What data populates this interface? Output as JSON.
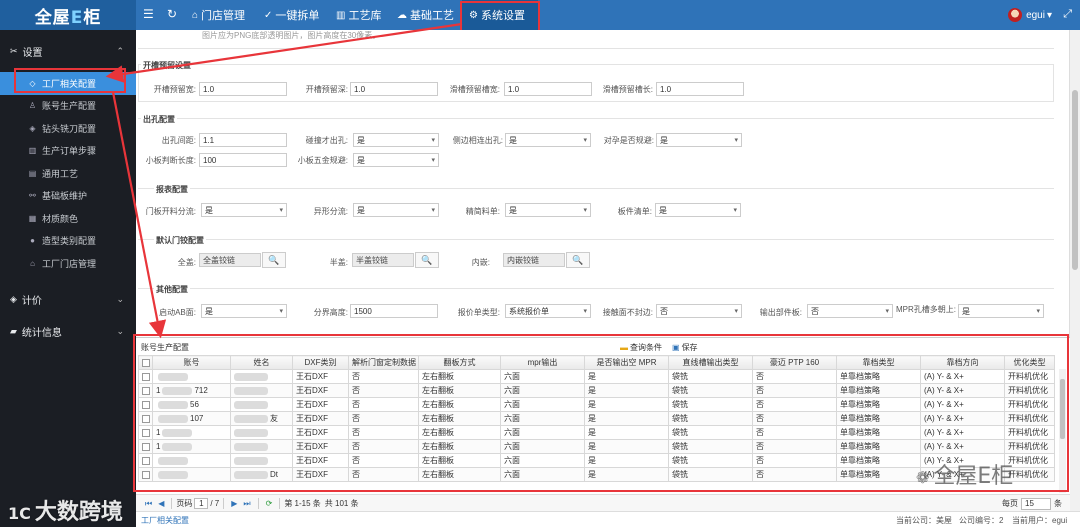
{
  "app": {
    "logo": {
      "part1": "全屋",
      "part2": "E",
      "part3": "柜"
    },
    "nav": [
      {
        "label": "门店管理",
        "glyph": "⌂"
      },
      {
        "label": "一键拆单",
        "glyph": "✓"
      },
      {
        "label": "工艺库",
        "glyph": "▥"
      },
      {
        "label": "基础工艺",
        "glyph": "☁"
      },
      {
        "label": "系统设置",
        "glyph": "⚙"
      }
    ],
    "user": "egui",
    "user_caret": "▾"
  },
  "sidebar": {
    "settings_label": "设置",
    "items": [
      "工厂相关配置",
      "账号生产配置",
      "钻头铣刀配置",
      "生产订单步骤",
      "通用工艺",
      "基础板维护",
      "材质颜色",
      "造型类别配置",
      "工厂门店管理"
    ],
    "pricing_label": "计价",
    "stats_label": "统计信息"
  },
  "form": {
    "hint": "图片应为PNG底部透明图片，图片高度在30像素。",
    "slot": {
      "title": "开槽预留设置",
      "slot_width_label": "开槽预留宽:",
      "slot_width": "1.0",
      "slot_depth_label": "开槽预留深:",
      "slot_depth": "1.0",
      "gap_width_label": "滑槽预留槽宽:",
      "gap_width": "1.0",
      "gap_length_label": "滑槽预留槽长:",
      "gap_length": "1.0"
    },
    "hole": {
      "title": "出孔配置",
      "spacing_label": "出孔间距:",
      "spacing": "1.1",
      "collide_label": "碰撞才出孔:",
      "collide": "是",
      "side_label": "侧边相连出孔:",
      "side": "是",
      "avoid_label": "对孕是否规避:",
      "avoid": "是",
      "min_len_label": "小板判断长度:",
      "min_len": "100",
      "small_hw_label": "小板五金规避:",
      "small_hw": "是"
    },
    "report": {
      "title": "报表配置",
      "door_label": "门板开料分流:",
      "door": "是",
      "special_label": "异形分流:",
      "special": "是",
      "simple_label": "精简料单:",
      "simple": "是",
      "part_list_label": "板件清单:",
      "part_list": "是"
    },
    "hinge": {
      "title": "默认门铰配置",
      "full_label": "全盖:",
      "full": "全盖铰链",
      "half_label": "半盖:",
      "half": "半盖铰链",
      "inner_label": "内嵌:",
      "inner": "内嵌铰链",
      "lookup_icon": "🔍"
    },
    "other": {
      "title": "其他配置",
      "ab_label": "启动AB面:",
      "ab": "是",
      "split_h_label": "分界高度:",
      "split_h": "1500",
      "quote_label": "报价单类型:",
      "quote": "系统报价单",
      "touch_label": "接触面不封边:",
      "touch": "否",
      "output_part_label": "输出部件板:",
      "output_part": "否",
      "mpr_label": "MPR孔槽多朝上:",
      "mpr": "是"
    }
  },
  "grid": {
    "title": "账号生产配置",
    "query_label": "查询条件",
    "save_label": "保存",
    "columns": [
      "账号",
      "姓名",
      "DXF类别",
      "解析门窗定制数据",
      "翻板方式",
      "mpr输出",
      "是否输出空 MPR",
      "直线槽输出类型",
      "豪迈 PTP 160",
      "靠档类型",
      "靠档方向",
      "优化类型"
    ],
    "rows": [
      {
        "account": "",
        "name": "",
        "dxf": "王石DXF",
        "parse": "否",
        "flip": "左右翻板",
        "mpr": "六面",
        "empty": "是",
        "line": "袋铣",
        "hm": "否",
        "dock": "单靠档策略",
        "dir": "(A) Y- & X+",
        "opt": "开料机优化"
      },
      {
        "account": "1",
        "account_suffix": "712",
        "name": "",
        "dxf": "王石DXF",
        "parse": "否",
        "flip": "左右翻板",
        "mpr": "六面",
        "empty": "是",
        "line": "袋铣",
        "hm": "否",
        "dock": "单靠档策略",
        "dir": "(A) Y- & X+",
        "opt": "开料机优化"
      },
      {
        "account": "",
        "account_suffix": "56",
        "name": "",
        "dxf": "王石DXF",
        "parse": "否",
        "flip": "左右翻板",
        "mpr": "六面",
        "empty": "是",
        "line": "袋铣",
        "hm": "否",
        "dock": "单靠档策略",
        "dir": "(A) Y- & X+",
        "opt": "开料机优化"
      },
      {
        "account": "",
        "account_suffix": "107",
        "name": "",
        "name_suffix": "友",
        "dxf": "王石DXF",
        "parse": "否",
        "flip": "左右翻板",
        "mpr": "六面",
        "empty": "是",
        "line": "袋铣",
        "hm": "否",
        "dock": "单靠档策略",
        "dir": "(A) Y- & X+",
        "opt": "开料机优化"
      },
      {
        "account": "1",
        "account_suffix": "",
        "name": "",
        "dxf": "王石DXF",
        "parse": "否",
        "flip": "左右翻板",
        "mpr": "六面",
        "empty": "是",
        "line": "袋铣",
        "hm": "否",
        "dock": "单靠档策略",
        "dir": "(A) Y- & X+",
        "opt": "开料机优化"
      },
      {
        "account": "1",
        "account_suffix": "",
        "name": "",
        "dxf": "王石DXF",
        "parse": "否",
        "flip": "左右翻板",
        "mpr": "六面",
        "empty": "是",
        "line": "袋铣",
        "hm": "否",
        "dock": "单靠档策略",
        "dir": "(A) Y- & X+",
        "opt": "开料机优化"
      },
      {
        "account": "",
        "account_suffix": "",
        "name": "",
        "dxf": "王石DXF",
        "parse": "否",
        "flip": "左右翻板",
        "mpr": "六面",
        "empty": "是",
        "line": "袋铣",
        "hm": "否",
        "dock": "单靠档策略",
        "dir": "(A) Y- & X+",
        "opt": "开料机优化"
      },
      {
        "account": "",
        "account_suffix": "",
        "name": "",
        "name_suffix": "Dt",
        "dxf": "王石DXF",
        "parse": "否",
        "flip": "左右翻板",
        "mpr": "六面",
        "empty": "是",
        "line": "袋铣",
        "hm": "否",
        "dock": "单靠档策略",
        "dir": "(A) Y- & X+",
        "opt": "开料机优化"
      }
    ],
    "pager": {
      "page_label": "页码",
      "page": "1",
      "total_pages": "/ 7",
      "range": "第 1-15 条",
      "total": "共 101 条",
      "per_page_label": "每页",
      "per_page": "15",
      "per_page_suffix": "条"
    }
  },
  "footer": {
    "left": "工厂相关配置",
    "location": "当前公司：美屋",
    "company_no": "公司编号：2",
    "current_user": "当前用户：egui"
  },
  "watermarks": {
    "left": "大数跨境",
    "left_logo": "1C",
    "right": "全屋E柜"
  },
  "colors": {
    "topbar": "#2f73b8",
    "sidebar": "#1b1e24",
    "active": "#3a8fdd",
    "annotation": "#e8353a"
  }
}
